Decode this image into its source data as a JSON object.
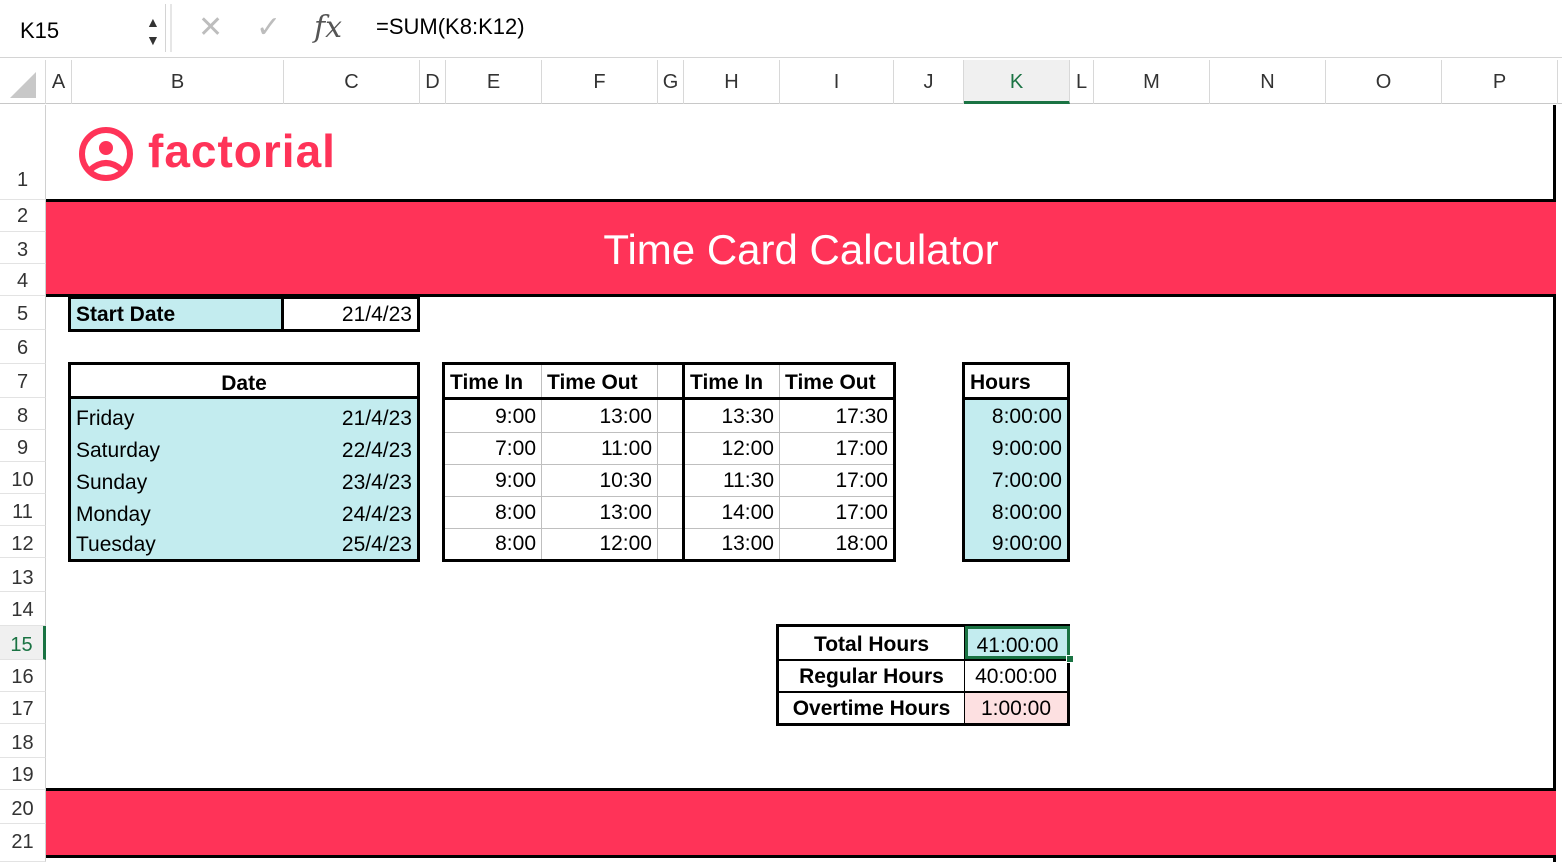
{
  "formula_bar": {
    "name_box": "K15",
    "cancel_icon": "✕",
    "enter_icon": "✓",
    "fx_label": "fx",
    "formula": "=SUM(K8:K12)"
  },
  "columns": [
    "A",
    "B",
    "C",
    "D",
    "E",
    "F",
    "G",
    "H",
    "I",
    "J",
    "K",
    "L",
    "M",
    "N",
    "O",
    "P"
  ],
  "selected_column": "K",
  "rows": [
    "1",
    "2",
    "3",
    "4",
    "5",
    "6",
    "7",
    "8",
    "9",
    "10",
    "11",
    "12",
    "13",
    "14",
    "15",
    "16",
    "17",
    "18",
    "19",
    "20",
    "21"
  ],
  "selected_row": "15",
  "logo": {
    "text": "factorial"
  },
  "title": "Time Card Calculator",
  "start_date": {
    "label": "Start Date",
    "value": "21/4/23"
  },
  "date_table": {
    "header": "Date",
    "rows": [
      {
        "day": "Friday",
        "date": "21/4/23"
      },
      {
        "day": "Saturday",
        "date": "22/4/23"
      },
      {
        "day": "Sunday",
        "date": "23/4/23"
      },
      {
        "day": "Monday",
        "date": "24/4/23"
      },
      {
        "day": "Tuesday",
        "date": "25/4/23"
      }
    ]
  },
  "times_table": {
    "headers": [
      "Time In",
      "Time Out",
      "Time In",
      "Time Out"
    ],
    "rows": [
      [
        "9:00",
        "13:00",
        "13:30",
        "17:30"
      ],
      [
        "7:00",
        "11:00",
        "12:00",
        "17:00"
      ],
      [
        "9:00",
        "10:30",
        "11:30",
        "17:00"
      ],
      [
        "8:00",
        "13:00",
        "14:00",
        "17:00"
      ],
      [
        "8:00",
        "12:00",
        "13:00",
        "18:00"
      ]
    ]
  },
  "hours_table": {
    "header": "Hours",
    "values": [
      "8:00:00",
      "9:00:00",
      "7:00:00",
      "8:00:00",
      "9:00:00"
    ]
  },
  "summary": {
    "total_label": "Total Hours",
    "total_value": "41:00:00",
    "regular_label": "Regular Hours",
    "regular_value": "40:00:00",
    "overtime_label": "Overtime Hours",
    "overtime_value": "1:00:00"
  },
  "colors": {
    "brand": "#ff3358",
    "cyan_fill": "#c3ecef",
    "overtime_fill": "#fde0e1",
    "selection": "#1a7343"
  }
}
